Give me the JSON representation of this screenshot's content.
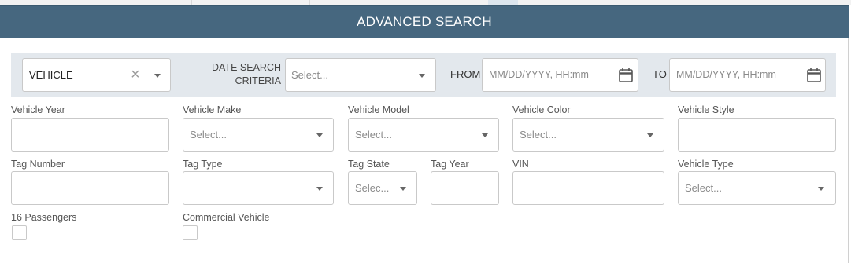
{
  "window": {
    "title": "ADVANCED SEARCH"
  },
  "criteria": {
    "search_type": {
      "value": "VEHICLE"
    },
    "date_search": {
      "label_line1": "DATE SEARCH",
      "label_line2": "CRITERIA",
      "placeholder": "Select..."
    },
    "from": {
      "label": "FROM",
      "placeholder": "MM/DD/YYYY, HH:mm"
    },
    "to": {
      "label": "TO",
      "placeholder": "MM/DD/YYYY, HH:mm"
    }
  },
  "fields": {
    "vehicle_year": {
      "label": "Vehicle Year"
    },
    "vehicle_make": {
      "label": "Vehicle Make",
      "placeholder": "Select..."
    },
    "vehicle_model": {
      "label": "Vehicle Model",
      "placeholder": "Select..."
    },
    "vehicle_color": {
      "label": "Vehicle Color",
      "placeholder": "Select..."
    },
    "vehicle_style": {
      "label": "Vehicle Style"
    },
    "tag_number": {
      "label": "Tag Number"
    },
    "tag_type": {
      "label": "Tag Type"
    },
    "tag_state": {
      "label": "Tag State",
      "placeholder": "Selec..."
    },
    "tag_year": {
      "label": "Tag Year"
    },
    "vin": {
      "label": "VIN"
    },
    "vehicle_type": {
      "label": "Vehicle Type",
      "placeholder": "Select..."
    },
    "passengers16": {
      "label": "16 Passengers",
      "checked": false
    },
    "commercial_vehicle": {
      "label": "Commercial Vehicle",
      "checked": false
    }
  },
  "icons": {
    "clear": "close-icon",
    "dropdown": "chevron-down-icon",
    "calendar": "calendar-icon"
  }
}
